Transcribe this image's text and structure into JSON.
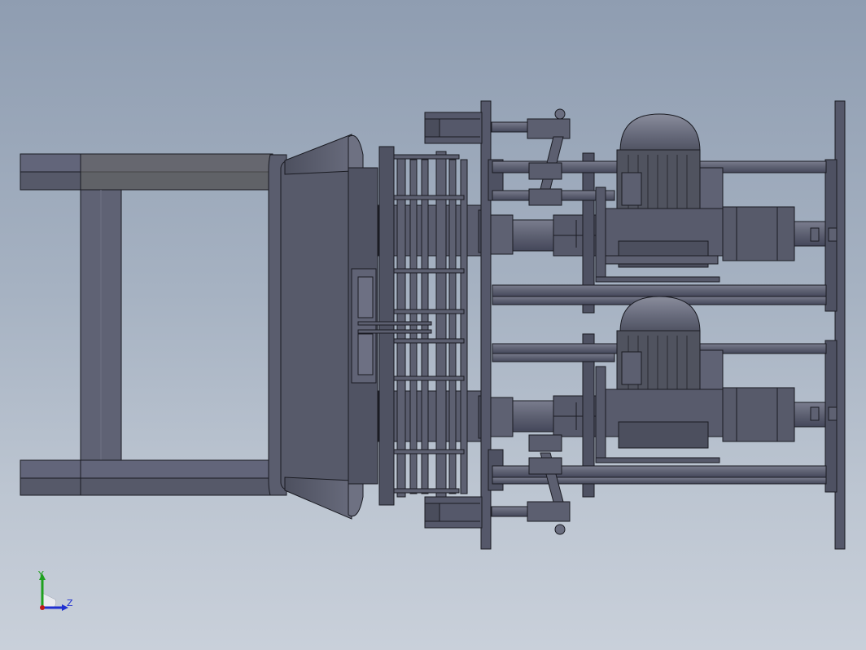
{
  "view": {
    "background_top": "#8f9db1",
    "background_bottom": "#c9d0da",
    "model_color": "#5c5f70",
    "edge_color": "#1a1b22"
  },
  "triad": {
    "y_label": "Y",
    "z_label": "Z",
    "y_color": "#1fa01f",
    "z_color": "#1f2fd0",
    "origin_color": "#c01818"
  }
}
